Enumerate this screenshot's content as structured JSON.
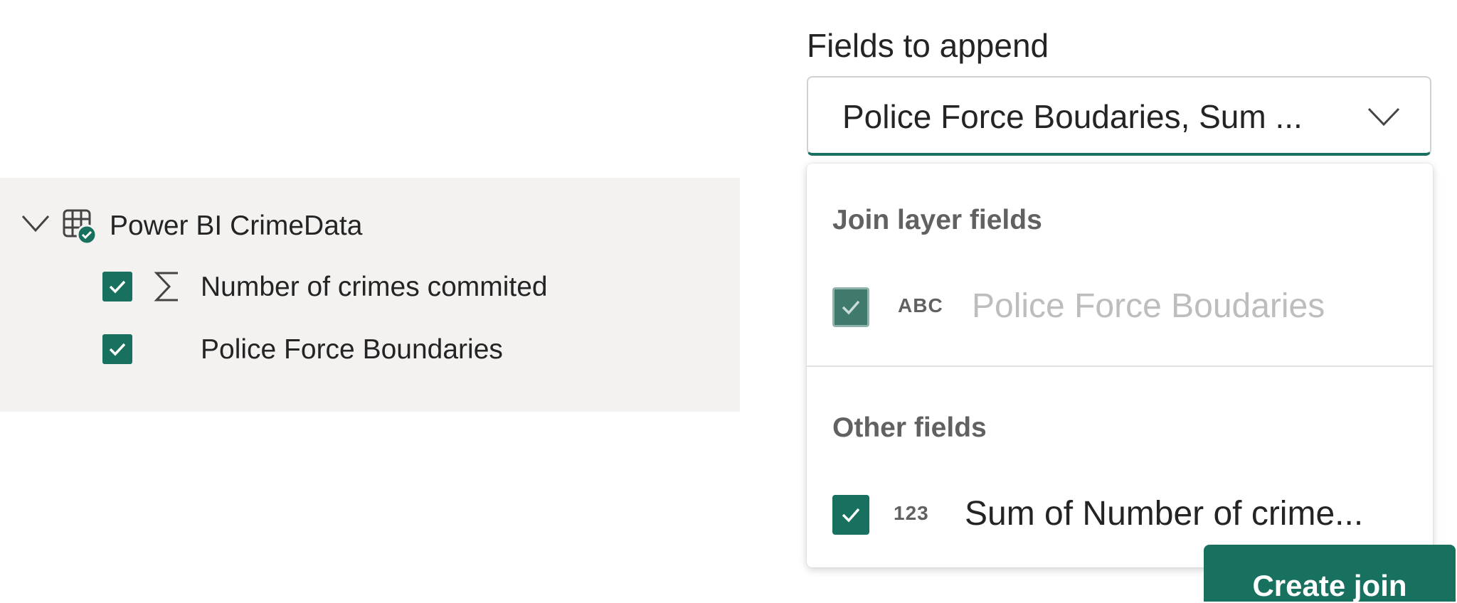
{
  "tree": {
    "dataset_label": "Power BI CrimeData",
    "fields": [
      {
        "label": "Number of crimes commited",
        "icon": "sigma-icon",
        "checked": true
      },
      {
        "label": "Police Force Boundaries",
        "icon": "",
        "checked": true
      }
    ]
  },
  "append": {
    "title": "Fields to append",
    "selected_value": "Police Force Boudaries, Sum ...",
    "groups": [
      {
        "header": "Join layer fields",
        "options": [
          {
            "type_badge": "ABC",
            "label": "Police Force Boudaries",
            "checked": true,
            "disabled": true
          }
        ]
      },
      {
        "header": "Other fields",
        "options": [
          {
            "type_badge": "123",
            "label": "Sum of Number of crime...",
            "checked": true,
            "disabled": false
          }
        ]
      }
    ]
  },
  "actions": {
    "create_join_label": "Create join"
  },
  "colors": {
    "accent": "#18705e",
    "panel_bg": "#f3f2f1",
    "muted_text": "#bdbdbd"
  }
}
